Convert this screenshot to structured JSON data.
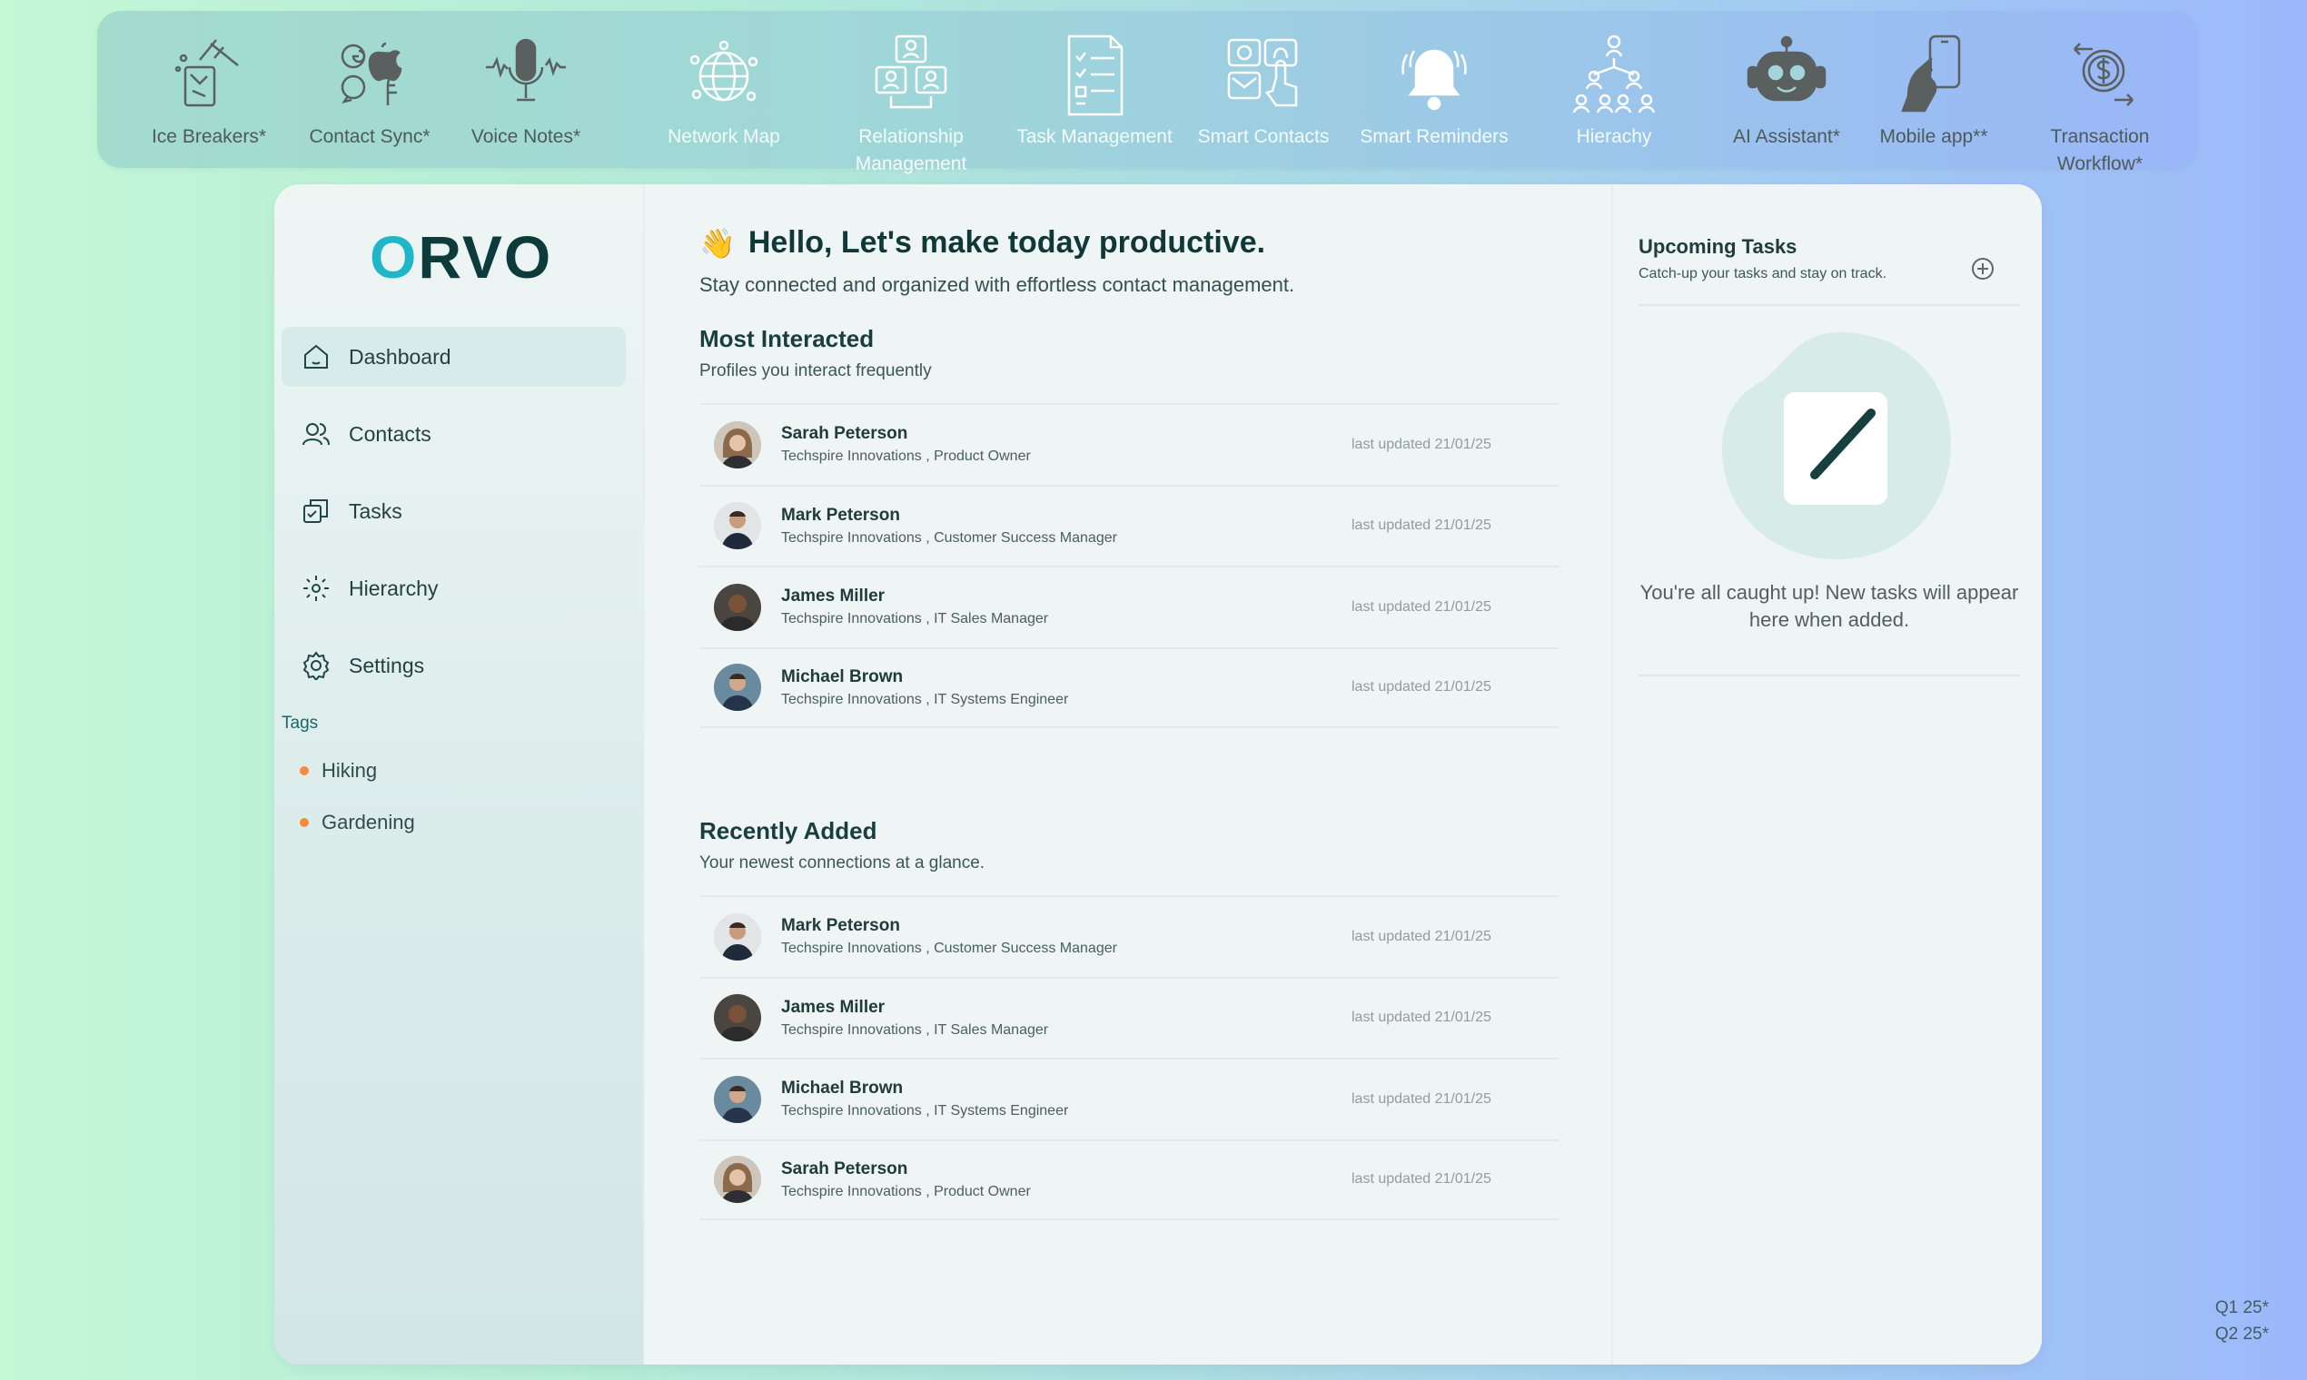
{
  "features": [
    {
      "label": "Ice Breakers*",
      "icon": "ice-breaker-icon",
      "tone": "dim"
    },
    {
      "label": "Contact Sync*",
      "icon": "contact-sync-icon",
      "tone": "dim"
    },
    {
      "label": "Voice Notes*",
      "icon": "microphone-icon",
      "tone": "dim"
    },
    {
      "label": "Network Map",
      "icon": "globe-network-icon",
      "tone": "bright"
    },
    {
      "label": "Relationship\nManagement",
      "icon": "relationship-icon",
      "tone": "bright"
    },
    {
      "label": "Task Management",
      "icon": "checklist-icon",
      "tone": "bright"
    },
    {
      "label": "Smart Contacts",
      "icon": "smart-contacts-icon",
      "tone": "bright"
    },
    {
      "label": "Smart Reminders",
      "icon": "bell-icon",
      "tone": "bright"
    },
    {
      "label": "Hierachy",
      "icon": "hierarchy-icon",
      "tone": "bright"
    },
    {
      "label": "AI Assistant*",
      "icon": "robot-icon",
      "tone": "dim"
    },
    {
      "label": "Mobile app**",
      "icon": "mobile-app-icon",
      "tone": "dim"
    },
    {
      "label": "Transaction\nWorkflow*",
      "icon": "transaction-icon",
      "tone": "dim"
    }
  ],
  "logo": {
    "text_o": "O",
    "text_rest": "RVO"
  },
  "nav": [
    {
      "label": "Dashboard",
      "icon": "home-icon",
      "active": true
    },
    {
      "label": "Contacts",
      "icon": "contacts-icon",
      "active": false
    },
    {
      "label": "Tasks",
      "icon": "tasks-icon",
      "active": false
    },
    {
      "label": "Hierarchy",
      "icon": "hierarchy-nav-icon",
      "active": false
    },
    {
      "label": "Settings",
      "icon": "gear-icon",
      "active": false
    }
  ],
  "tags": {
    "heading": "Tags",
    "items": [
      "Hiking",
      "Gardening"
    ],
    "dot_color": "#f48b3a"
  },
  "main": {
    "greeting": "Hello, Let's make today productive.",
    "greeting_emoji": "👋",
    "subtext": "Stay connected and organized with effortless contact management.",
    "most_interacted": {
      "title": "Most Interacted",
      "subtitle": "Profiles you interact frequently",
      "rows": [
        {
          "name": "Sarah Peterson",
          "role": "Techspire Innovations , Product Owner",
          "updated": "last updated 21/01/25"
        },
        {
          "name": "Mark Peterson",
          "role": "Techspire Innovations , Customer Success Manager",
          "updated": "last updated 21/01/25"
        },
        {
          "name": "James Miller",
          "role": "Techspire Innovations , IT Sales Manager",
          "updated": "last updated 21/01/25"
        },
        {
          "name": "Michael Brown",
          "role": "Techspire Innovations , IT Systems Engineer",
          "updated": "last updated 21/01/25"
        }
      ]
    },
    "recently_added": {
      "title": "Recently Added",
      "subtitle": "Your newest connections at a glance.",
      "rows": [
        {
          "name": "Mark Peterson",
          "role": "Techspire Innovations , Customer Success Manager",
          "updated": "last updated 21/01/25"
        },
        {
          "name": "James Miller",
          "role": "Techspire Innovations , IT Sales Manager",
          "updated": "last updated 21/01/25"
        },
        {
          "name": "Michael Brown",
          "role": "Techspire Innovations , IT Systems Engineer",
          "updated": "last updated 21/01/25"
        },
        {
          "name": "Sarah Peterson",
          "role": "Techspire Innovations , Product Owner",
          "updated": "last updated 21/01/25"
        }
      ]
    }
  },
  "upcoming": {
    "title": "Upcoming Tasks",
    "subtitle": "Catch-up your tasks and stay on track.",
    "add_icon": "plus-circle-icon",
    "empty_text": "You're all caught up! New tasks will appear here when added."
  },
  "footnotes": [
    "Q1 25*",
    "Q2 25*"
  ],
  "colors": {
    "accent": "#1fb7c7",
    "brand_dark": "#0d3b3b",
    "active_nav": "#d7ecea",
    "tag_dot": "#f48b3a"
  }
}
